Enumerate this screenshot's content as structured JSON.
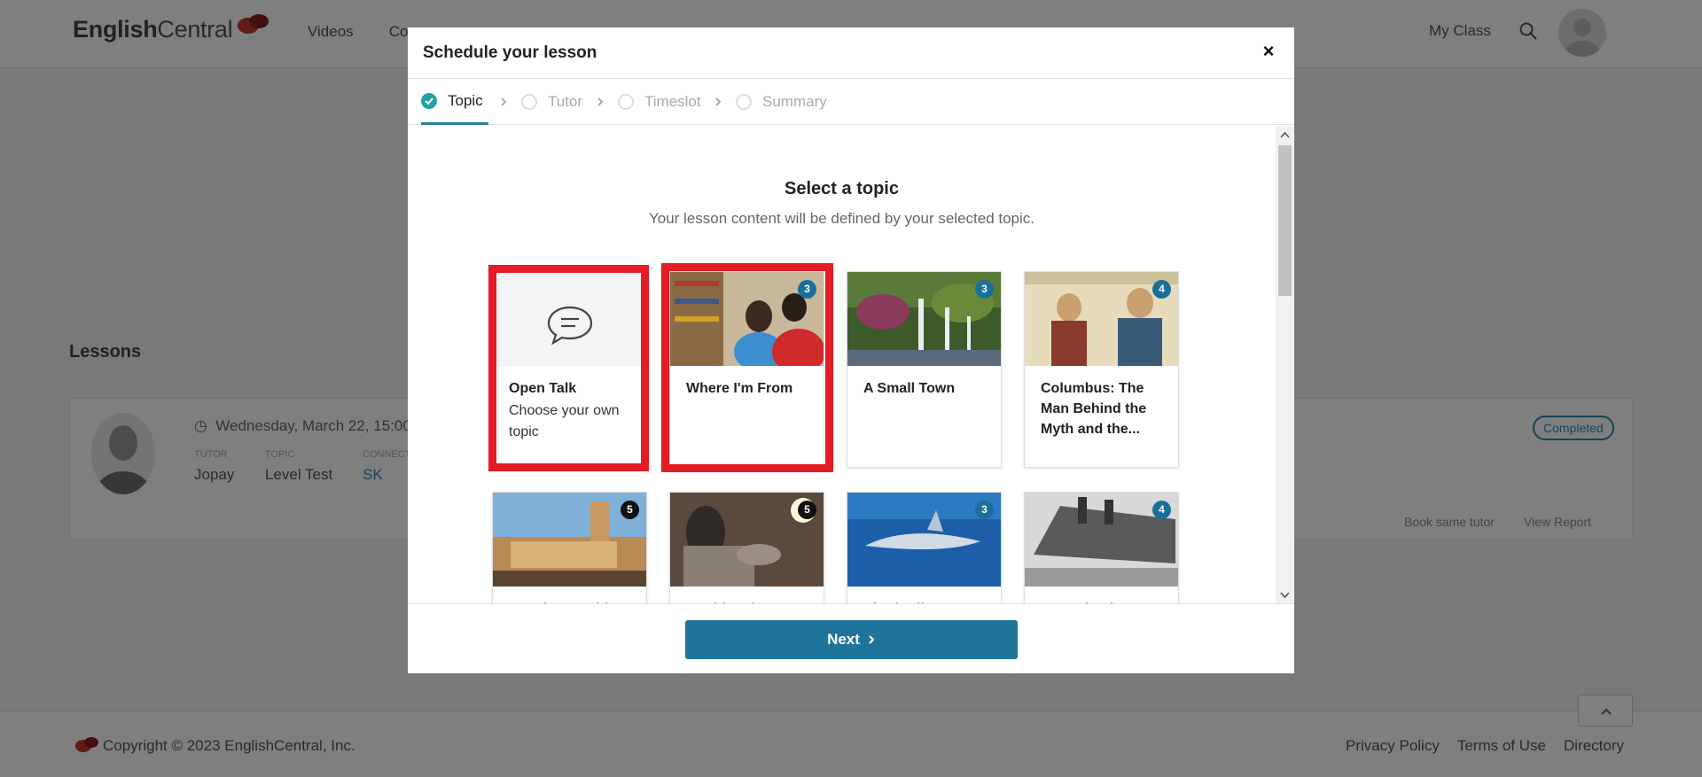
{
  "app": {
    "logo_text_bold": "English",
    "logo_text_thin": "Central",
    "nav": [
      "Videos",
      "Co",
      "",
      "",
      ""
    ],
    "my_class": "My Class"
  },
  "lessons": {
    "title": "Lessons",
    "card": {
      "date": "Wednesday, March 22, 15:00",
      "tutor_label": "TUTOR",
      "tutor": "Jopay",
      "topic_label": "TOPIC",
      "topic": "Level Test",
      "channel_label": "CONNECT",
      "channel": "SK",
      "status": "Completed",
      "book_same": "Book same tutor",
      "view_report": "View Report"
    }
  },
  "footer": {
    "copyright": "Copyright © 2023 EnglishCentral, Inc.",
    "links": [
      "Privacy Policy",
      "Terms of Use",
      "Directory"
    ]
  },
  "modal": {
    "title": "Schedule your lesson",
    "close": "×",
    "steps": [
      {
        "label": "Topic",
        "active": true
      },
      {
        "label": "Tutor",
        "active": false
      },
      {
        "label": "Timeslot",
        "active": false
      },
      {
        "label": "Summary",
        "active": false
      }
    ],
    "select_title": "Select a topic",
    "select_subtitle": "Your lesson content will be defined by your selected topic.",
    "cards": [
      {
        "title": "Open Talk",
        "subtitle": "Choose your own topic",
        "badge": "",
        "icon": "chat-bubble-icon"
      },
      {
        "title": "Where I'm From",
        "subtitle": "",
        "badge": "3"
      },
      {
        "title": "A Small Town",
        "subtitle": "",
        "badge": "3"
      },
      {
        "title": "Columbus: The Man Behind the Myth and the...",
        "subtitle": "",
        "badge": "4"
      },
      {
        "title": "Russia's Maritime",
        "subtitle": "",
        "badge": "5"
      },
      {
        "title": "World's Biggest",
        "subtitle": "",
        "badge": "5"
      },
      {
        "title": "Shark Alley: Close",
        "subtitle": "",
        "badge": "3"
      },
      {
        "title": "RMS Titanic: A",
        "subtitle": "",
        "badge": "4"
      }
    ],
    "next_label": "Next"
  },
  "colors": {
    "accent": "#1f7499",
    "highlight": "#e31c25",
    "badge_blue": "#1a6f99",
    "badge_black": "#111111"
  }
}
